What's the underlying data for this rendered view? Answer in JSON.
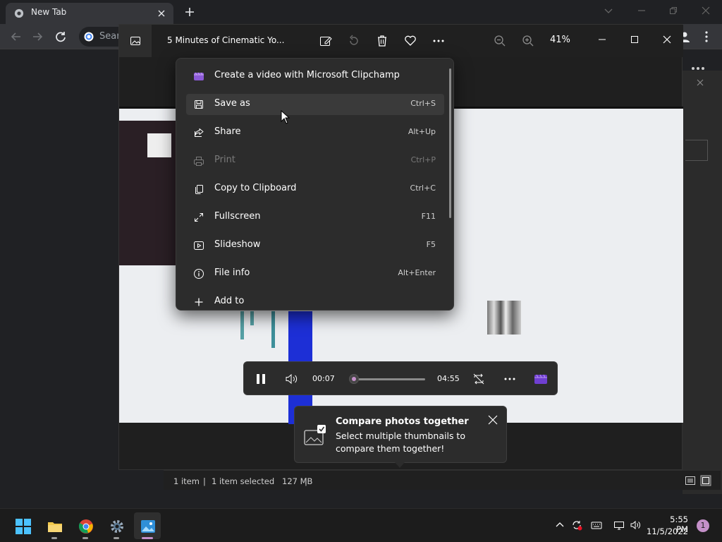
{
  "chrome": {
    "tab_title": "New Tab",
    "omnibox_placeholder": "Sear"
  },
  "photos": {
    "file_title": "5 Minutes of Cinematic Yo...",
    "zoom": "41%"
  },
  "context_menu": {
    "items": [
      {
        "label": "Create a video with Microsoft Clipchamp",
        "shortcut": "",
        "icon": "clipchamp-icon"
      },
      {
        "label": "Save as",
        "shortcut": "Ctrl+S",
        "icon": "save-icon"
      },
      {
        "label": "Share",
        "shortcut": "Alt+Up",
        "icon": "share-icon"
      },
      {
        "label": "Print",
        "shortcut": "Ctrl+P",
        "icon": "print-icon",
        "disabled": true
      },
      {
        "label": "Copy to Clipboard",
        "shortcut": "Ctrl+C",
        "icon": "copy-icon"
      },
      {
        "label": "Fullscreen",
        "shortcut": "F11",
        "icon": "fullscreen-icon"
      },
      {
        "label": "Slideshow",
        "shortcut": "F5",
        "icon": "slideshow-icon"
      },
      {
        "label": "File info",
        "shortcut": "Alt+Enter",
        "icon": "info-icon"
      },
      {
        "label": "Add to",
        "shortcut": "",
        "icon": "plus-icon"
      }
    ]
  },
  "video": {
    "current_time": "00:07",
    "total_time": "04:55",
    "progress": 0.024
  },
  "teaching_tip": {
    "title": "Compare photos together",
    "body": "Select multiple thumbnails to compare them together!"
  },
  "statusbar": {
    "item_count": "1 item",
    "separator": "|",
    "selected": "1 item selected",
    "size": "127 MB"
  },
  "taskbar": {
    "time": "5:55 PM",
    "date": "11/5/2022",
    "notifications": "1"
  },
  "colors": {
    "accent": "#c490c9",
    "menu_bg": "#2c2c2c",
    "chrome_bg": "#202124"
  }
}
